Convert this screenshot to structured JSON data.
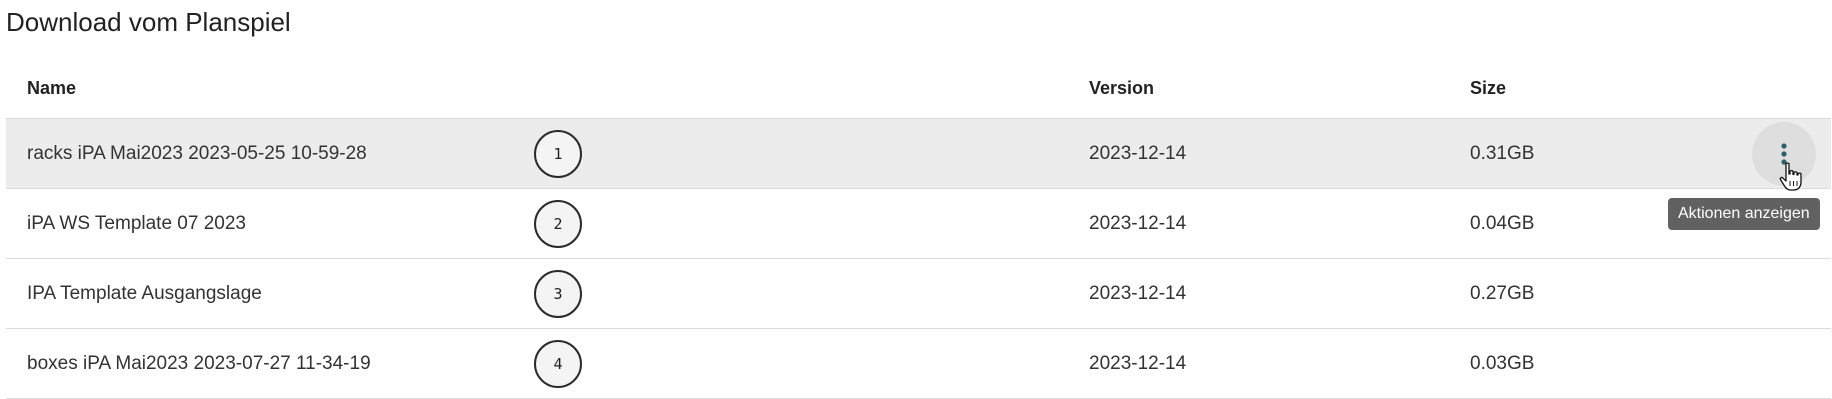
{
  "page": {
    "title": "Download vom Planspiel"
  },
  "table": {
    "columns": {
      "name": "Name",
      "version": "Version",
      "size": "Size"
    },
    "rows": [
      {
        "badge": "1",
        "name": "racks iPA Mai2023 2023-05-25 10-59-28",
        "version": "2023-12-14",
        "size": "0.31GB"
      },
      {
        "badge": "2",
        "name": "iPA WS Template 07 2023",
        "version": "2023-12-14",
        "size": "0.04GB"
      },
      {
        "badge": "3",
        "name": "IPA Template Ausgangslage",
        "version": "2023-12-14",
        "size": "0.27GB"
      },
      {
        "badge": "4",
        "name": "boxes iPA Mai2023 2023-07-27 11-34-19",
        "version": "2023-12-14",
        "size": "0.03GB"
      }
    ]
  },
  "actions": {
    "icon": "more-vert-icon",
    "tooltip": "Aktionen anzeigen"
  },
  "colors": {
    "hover_row": "#ececec",
    "tooltip_bg": "#616161",
    "menu_dots": "#2f5f6e"
  }
}
